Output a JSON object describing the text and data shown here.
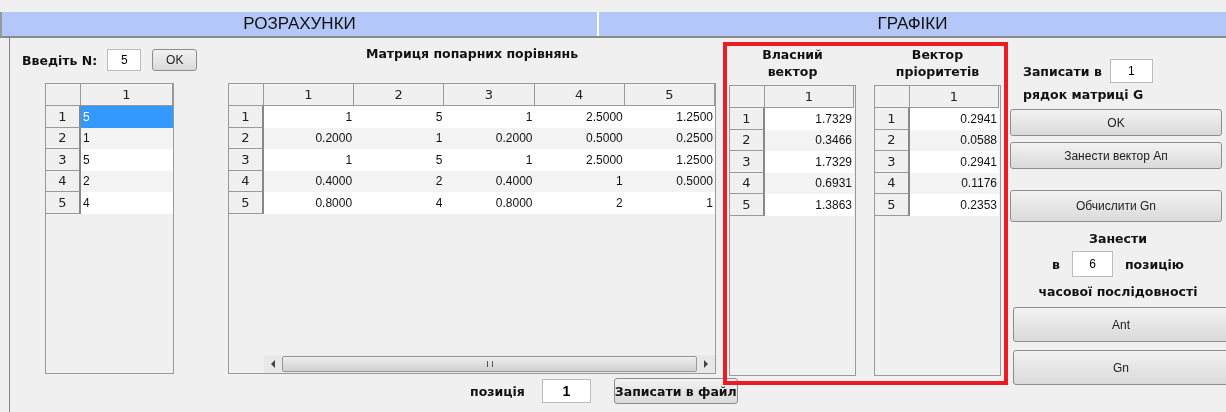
{
  "section_headers": [
    "РОЗРАХУНКИ",
    "ГРАФІКИ"
  ],
  "n_input": {
    "label": "Введіть N:",
    "value": "5",
    "button": "OK"
  },
  "input_table": {
    "columns": [
      "1"
    ],
    "rows": [
      {
        "header": "1",
        "cells": [
          "5"
        ],
        "selected": true
      },
      {
        "header": "2",
        "cells": [
          "1"
        ],
        "selected": false
      },
      {
        "header": "3",
        "cells": [
          "5"
        ],
        "selected": false
      },
      {
        "header": "4",
        "cells": [
          "2"
        ],
        "selected": false
      },
      {
        "header": "5",
        "cells": [
          "4"
        ],
        "selected": false
      }
    ]
  },
  "matrix": {
    "title": "Матриця попарних порівнянь",
    "columns": [
      "1",
      "2",
      "3",
      "4",
      "5"
    ],
    "rows": [
      {
        "header": "1",
        "cells": [
          "1",
          "5",
          "1",
          "2.5000",
          "1.2500"
        ]
      },
      {
        "header": "2",
        "cells": [
          "0.2000",
          "1",
          "0.2000",
          "0.5000",
          "0.2500"
        ]
      },
      {
        "header": "3",
        "cells": [
          "1",
          "5",
          "1",
          "2.5000",
          "1.2500"
        ]
      },
      {
        "header": "4",
        "cells": [
          "0.4000",
          "2",
          "0.4000",
          "1",
          "0.5000"
        ]
      },
      {
        "header": "5",
        "cells": [
          "0.8000",
          "4",
          "0.8000",
          "2",
          "1"
        ]
      }
    ]
  },
  "vectors": [
    {
      "title": "Власний вектор",
      "columns": [
        "1"
      ],
      "rows": [
        {
          "header": "1",
          "cells": [
            "1.7329"
          ]
        },
        {
          "header": "2",
          "cells": [
            "0.3466"
          ]
        },
        {
          "header": "3",
          "cells": [
            "1.7329"
          ]
        },
        {
          "header": "4",
          "cells": [
            "0.6931"
          ]
        },
        {
          "header": "5",
          "cells": [
            "1.3863"
          ]
        }
      ]
    },
    {
      "title": "Вектор пріоритетів",
      "columns": [
        "1"
      ],
      "rows": [
        {
          "header": "1",
          "cells": [
            "0.2941"
          ]
        },
        {
          "header": "2",
          "cells": [
            "0.0588"
          ]
        },
        {
          "header": "3",
          "cells": [
            "0.2941"
          ]
        },
        {
          "header": "4",
          "cells": [
            "0.1176"
          ]
        },
        {
          "header": "5",
          "cells": [
            "0.2353"
          ]
        }
      ]
    }
  ],
  "right_panel": {
    "write_label": "Записати в",
    "write_value": "1",
    "write_label_2": "рядок матриці G",
    "ok_button": "OK",
    "add_vector_button": "Занести вектор Ап",
    "compute_button": "Обчислити Gn",
    "add_label": "Занести",
    "in_label": "в",
    "position_value": "6",
    "position_label": "позицію",
    "series_label": "часової послідовності",
    "ant_button": "Ant",
    "gn_button": "Gn"
  },
  "bottom": {
    "label": "позиція",
    "value": "1",
    "button": "Записати в файл"
  }
}
